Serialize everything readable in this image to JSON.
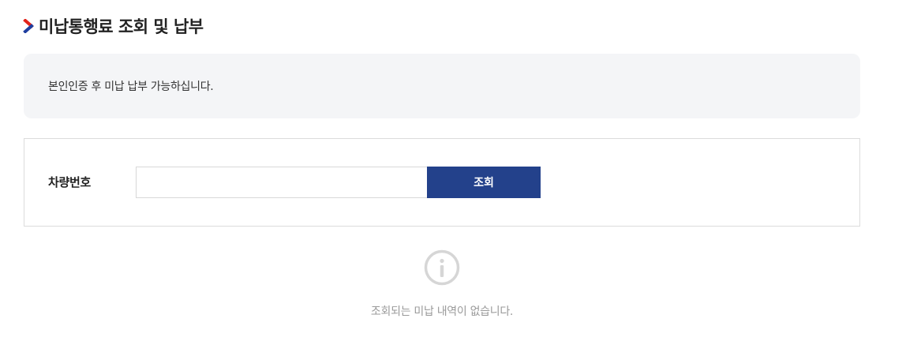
{
  "page": {
    "title": "미납통행료 조회 및 납부",
    "title_icon": "chevron-right-icon"
  },
  "notice": {
    "text": "본인인증 후 미납 납부 가능하십니다."
  },
  "search": {
    "label": "차량번호",
    "input_value": "",
    "input_placeholder": "",
    "button_label": "조회"
  },
  "result": {
    "icon": "info-circle-icon",
    "empty_message": "조회되는 미납 내역이 없습니다."
  },
  "colors": {
    "primary": "#23418b",
    "chevron_blue": "#1f3fa0",
    "chevron_red": "#e2231a",
    "notice_bg": "#f4f5f7",
    "empty_text": "#9a9a9a",
    "info_icon": "#d6d6d6"
  }
}
